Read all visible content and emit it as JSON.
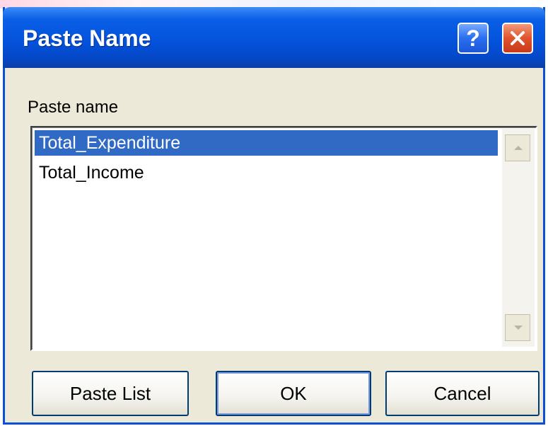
{
  "window": {
    "title": "Paste Name",
    "help_glyph": "?",
    "close_icon": "close-icon"
  },
  "list": {
    "label": "Paste name",
    "items": [
      {
        "label": "Total_Expenditure",
        "selected": true
      },
      {
        "label": "Total_Income",
        "selected": false
      }
    ]
  },
  "buttons": {
    "paste_list": "Paste List",
    "ok": "OK",
    "cancel": "Cancel"
  },
  "colors": {
    "titlebar": "#0453dc",
    "selection": "#316ac5",
    "close": "#e0532d",
    "dialog_bg": "#ece9d8"
  }
}
